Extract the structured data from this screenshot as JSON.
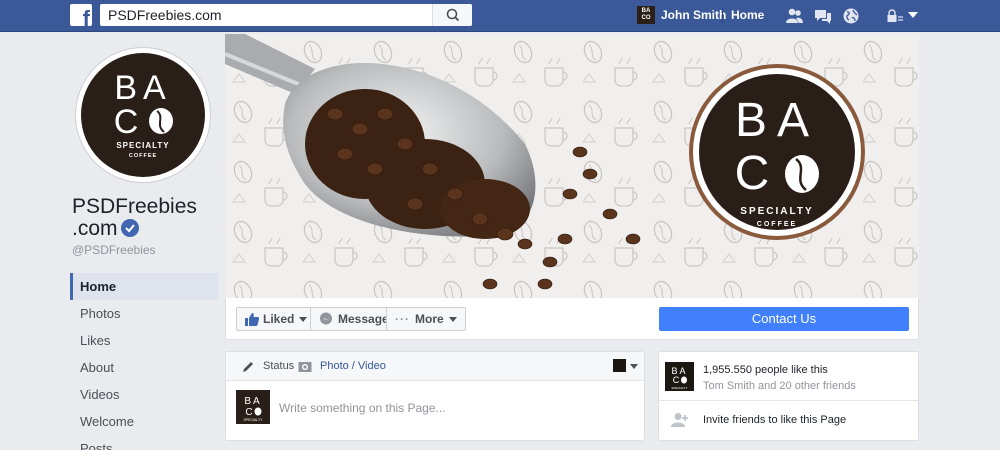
{
  "topbar": {
    "search_value": "PSDFreebies.com",
    "search_placeholder": "Search",
    "user_name": "John Smith",
    "home_label": "Home"
  },
  "brand": {
    "line1": "BA",
    "line2": "CO",
    "tagline": "SPECIALTY",
    "subtag": "COFFEE"
  },
  "page": {
    "name_line1": "PSDFreebies",
    "name_line2": ".com",
    "handle": "@PSDFreebies"
  },
  "sidebar": {
    "items": [
      {
        "label": "Home",
        "active": true
      },
      {
        "label": "Photos"
      },
      {
        "label": "Likes"
      },
      {
        "label": "About"
      },
      {
        "label": "Videos"
      },
      {
        "label": "Welcome"
      },
      {
        "label": "Posts"
      }
    ]
  },
  "actions": {
    "liked": "Liked",
    "message": "Message",
    "more": "More",
    "contact": "Contact Us"
  },
  "composer": {
    "status_tab": "Status",
    "photo_tab": "Photo / Video",
    "placeholder": "Write something on this Page..."
  },
  "likes_card": {
    "count": "1,955.550 people like this",
    "friends": "Tom Smith and 20 other friends",
    "invite": "Invite friends to like this Page"
  },
  "colors": {
    "facebook_blue": "#3b5998",
    "contact_blue": "#4080ff",
    "brand_dark": "#2a1f18"
  }
}
